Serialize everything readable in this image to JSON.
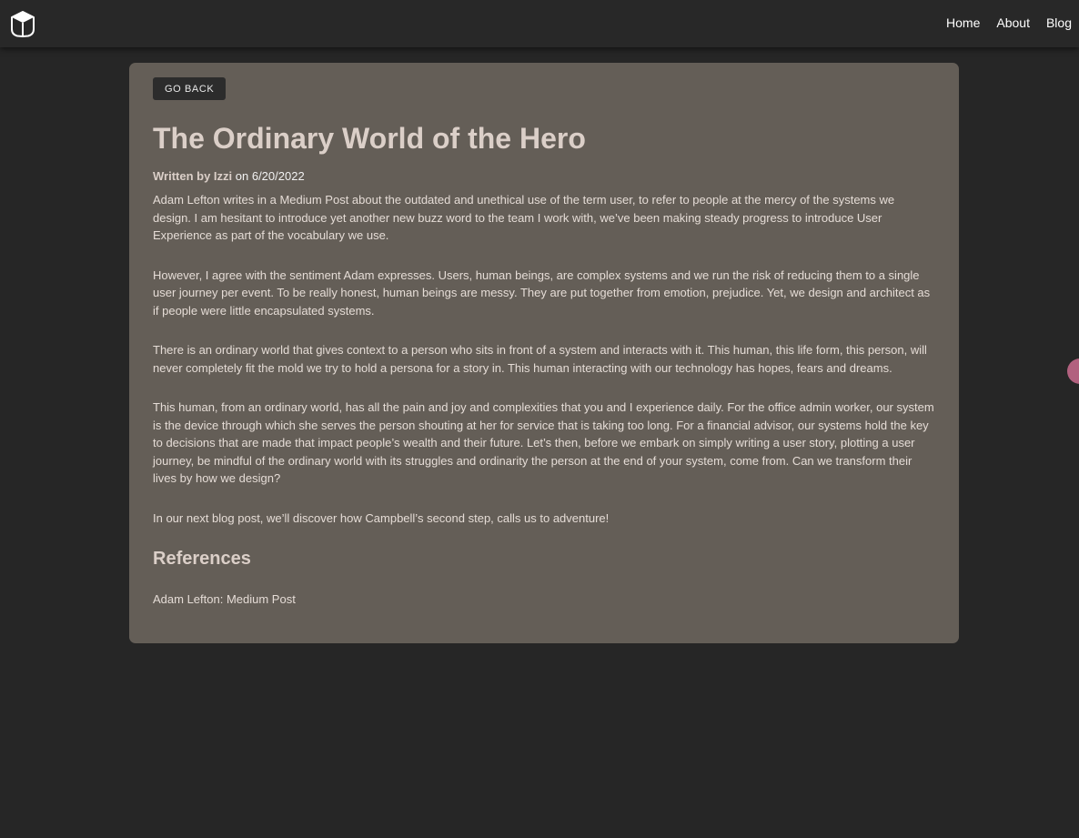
{
  "header": {
    "logo_icon": "cube-logo-icon",
    "nav": [
      {
        "label": "Home"
      },
      {
        "label": "About"
      },
      {
        "label": "Blog"
      }
    ]
  },
  "post": {
    "back_label": "GO BACK",
    "title": "The Ordinary World of the Hero",
    "byline_prefix": "Written by Izzi",
    "byline_suffix": " on 6/20/2022",
    "paragraphs": [
      "Adam Lefton writes in a Medium Post about the outdated and unethical use of the term user, to refer to people at the mercy of the systems we design. I am hesitant to introduce yet another new buzz word to the team I work with, we’ve been making steady progress to introduce User Experience as part of the vocabulary we use.",
      "However, I agree with the sentiment Adam expresses. Users, human beings, are complex systems and we run the risk of reducing them to a single user journey per event. To be really honest, human beings are messy. They are put together from emotion, prejudice. Yet, we design and architect as if people were little encapsulated systems.",
      "There is an ordinary world that gives context to a person who sits in front of a system and interacts with it. This human, this life form, this person, will never completely fit the mold we try to hold a persona for a story in. This human interacting with our technology has hopes, fears and dreams.",
      "This human, from an ordinary world, has all the pain and joy and complexities that you and I experience daily. For the office admin worker, our system is the device through which she serves the person shouting at her for service that is taking too long. For a financial advisor, our systems hold the key to decisions that are made that impact people’s wealth and their future. Let’s then, before we embark on simply writing a user story, plotting a user journey, be mindful of the ordinary world with its struggles and ordinarity the person at the end of your system, come from. Can we transform their lives by how we design?",
      "In our next blog post, we’ll discover how Campbell’s second step, calls us to adventure!"
    ],
    "references_heading": "References",
    "references": [
      {
        "label": "Adam Lefton: Medium Post"
      }
    ]
  },
  "colors": {
    "page_bg": "#262626",
    "header_bg": "#282828",
    "card_bg": "#645e57",
    "title_text": "#dbcfc8",
    "accent_bubble": "#b2617f"
  }
}
